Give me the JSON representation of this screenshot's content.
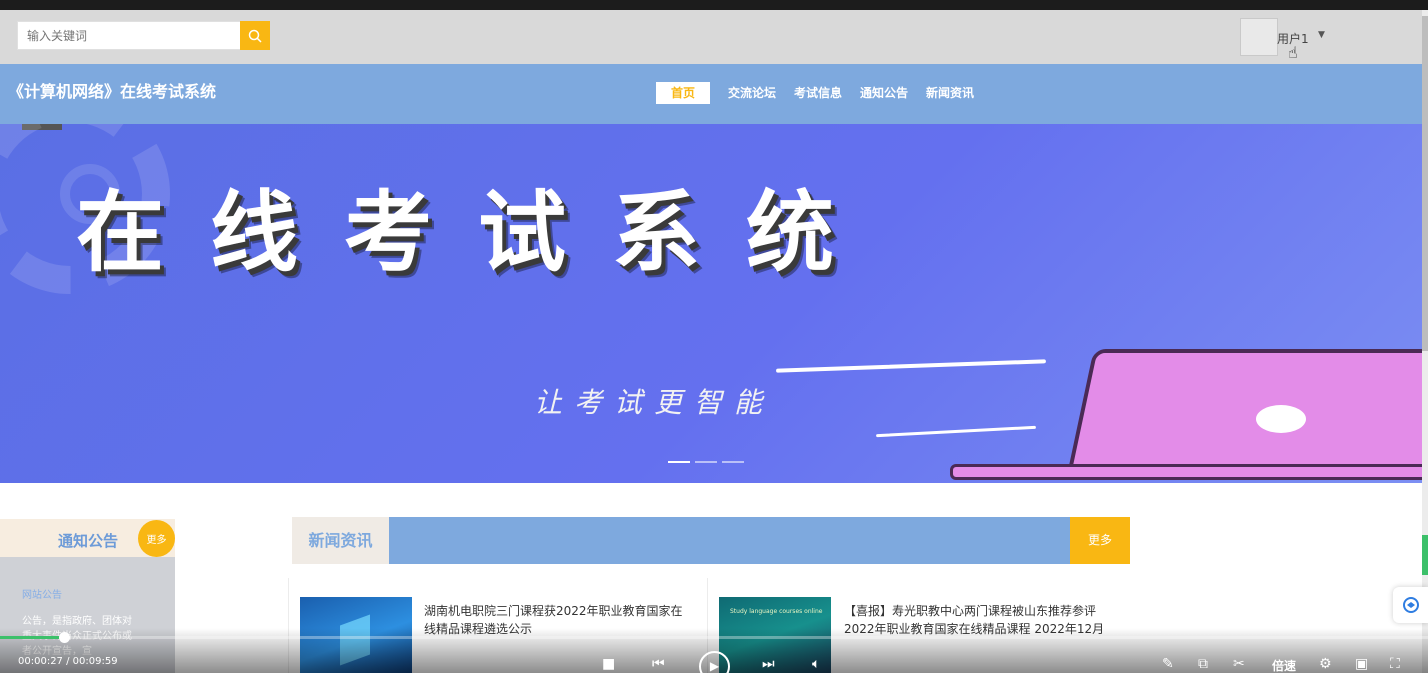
{
  "search": {
    "placeholder": "输入关键词"
  },
  "user": {
    "name": "用户1"
  },
  "site": {
    "title": "《计算机网络》在线考试系统"
  },
  "nav": {
    "items": [
      "首页",
      "交流论坛",
      "考试信息",
      "通知公告",
      "新闻资讯"
    ],
    "active_index": 0
  },
  "banner": {
    "title": "在线考试系统",
    "subtitle": "让考试更智能",
    "slide_count": 3,
    "active_slide": 0
  },
  "notice": {
    "title": "通知公告",
    "more_label": "更多",
    "category": "网站公告",
    "text": "公告，是指政府、团体对重大事件当众正式公布或者公开宣告，宣"
  },
  "news": {
    "title": "新闻资讯",
    "more_label": "更多",
    "items": [
      {
        "title": "湖南机电职院三门课程获2022年职业教育国家在线精品课程遴选公示"
      },
      {
        "title": "【喜报】寿光职教中心两门课程被山东推荐参评2022年职业教育国家在线精品课程 2022年12月1..."
      }
    ],
    "thumb2_text": "Study language courses online"
  },
  "player": {
    "time": "00:00:27 / 00:09:59",
    "progress": 0.045,
    "speed_label": "倍速"
  },
  "colors": {
    "nav_blue": "#7ea9de",
    "accent_yellow": "#f9b713",
    "banner_blue": "#6470ef"
  }
}
